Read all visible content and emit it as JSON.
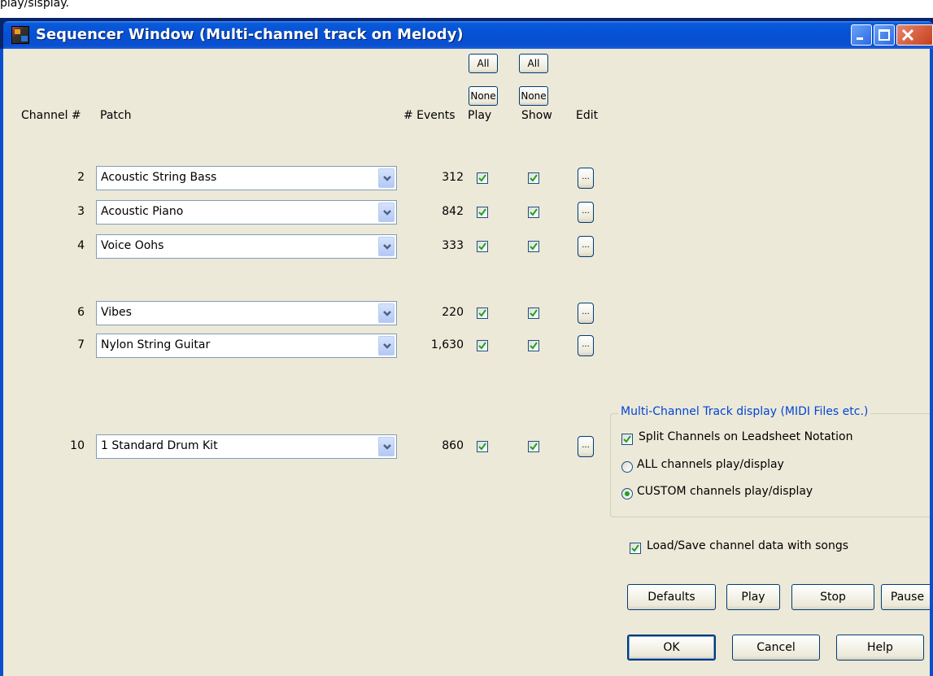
{
  "stray_text": "play/sisplay.",
  "window": {
    "title": "Sequencer Window  (Multi-channel track on Melody)",
    "controls": [
      "minimize",
      "maximize",
      "close"
    ]
  },
  "header_buttons": {
    "play_all": "All",
    "show_all": "All",
    "play_none": "None",
    "show_none": "None"
  },
  "columns": {
    "channel": "Channel #",
    "patch": "Patch",
    "events": "# Events",
    "play": "Play",
    "show": "Show",
    "edit": "Edit"
  },
  "rows": [
    {
      "channel": "2",
      "patch": "Acoustic String Bass",
      "events": "312",
      "play": true,
      "show": true,
      "edit": "..."
    },
    {
      "channel": "3",
      "patch": "Acoustic Piano",
      "events": "842",
      "play": true,
      "show": true,
      "edit": "..."
    },
    {
      "channel": "4",
      "patch": "Voice Oohs",
      "events": "333",
      "play": true,
      "show": true,
      "edit": "..."
    },
    {
      "channel": "6",
      "patch": "Vibes",
      "events": "220",
      "play": true,
      "show": true,
      "edit": "..."
    },
    {
      "channel": "7",
      "patch": "Nylon String Guitar",
      "events": "1,630",
      "play": true,
      "show": true,
      "edit": "..."
    },
    {
      "channel": "10",
      "patch": "1 Standard Drum Kit",
      "events": "860",
      "play": true,
      "show": true,
      "edit": "..."
    }
  ],
  "display_group": {
    "title": "Multi-Channel Track display (MIDI Files etc.)",
    "split_label": "Split Channels on Leadsheet Notation",
    "split_checked": true,
    "all_label": "ALL channels play/display",
    "custom_label": "CUSTOM channels play/display",
    "selected": "custom"
  },
  "load_save": {
    "label": "Load/Save channel data with songs",
    "checked": true
  },
  "buttons": {
    "defaults": "Defaults",
    "play": "Play",
    "stop": "Stop",
    "pause": "Pause",
    "ok": "OK",
    "cancel": "Cancel",
    "help": "Help"
  },
  "colors": {
    "title_bar": "#0a5ad9",
    "dialog_bg": "#ece9d8",
    "check_mark": "#21a121",
    "group_title": "#0046d5"
  }
}
